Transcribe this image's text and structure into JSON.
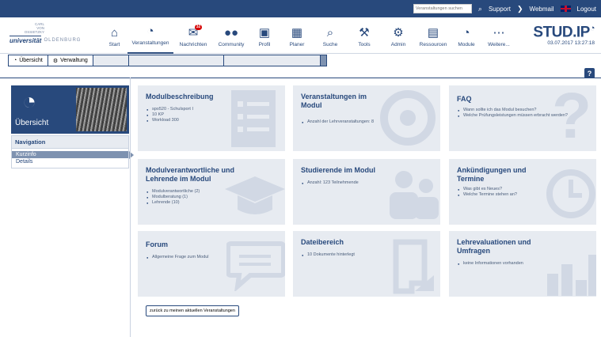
{
  "topbar": {
    "search_placeholder": "Veranstaltungen suchen",
    "support": "Support",
    "webmail": "Webmail",
    "logout": "Logout"
  },
  "logo": {
    "top_line1": "CARL",
    "top_line2": "VON",
    "top_line3": "OSSIETZKY",
    "universitaet": "universität",
    "oldenburg": "OLDENBURG"
  },
  "nav": [
    {
      "label": "Start",
      "icon": "home-icon",
      "glyph": "⌂"
    },
    {
      "label": "Veranstaltungen",
      "icon": "seminar-icon",
      "glyph": "◔"
    },
    {
      "label": "Nachrichten",
      "icon": "mail-icon",
      "glyph": "✉",
      "badge": "32"
    },
    {
      "label": "Community",
      "icon": "community-icon",
      "glyph": "👥"
    },
    {
      "label": "Profil",
      "icon": "profile-icon",
      "glyph": "▣"
    },
    {
      "label": "Planer",
      "icon": "calendar-icon",
      "glyph": "▦"
    },
    {
      "label": "Suche",
      "icon": "search-icon",
      "glyph": "⌕"
    },
    {
      "label": "Tools",
      "icon": "tools-icon",
      "glyph": "🔧"
    },
    {
      "label": "Admin",
      "icon": "admin-icon",
      "glyph": "⚙"
    },
    {
      "label": "Ressourcen",
      "icon": "resources-icon",
      "glyph": "▤"
    },
    {
      "label": "Module",
      "icon": "module-icon",
      "glyph": "◔"
    },
    {
      "label": "Weitere...",
      "icon": "more-icon",
      "glyph": "⋯"
    }
  ],
  "brand": {
    "name": "STUD.IP",
    "datetime": "03.07.2017 13:27:18"
  },
  "tabs": [
    {
      "label": "Übersicht",
      "icon": "seminar-icon"
    },
    {
      "label": "Verwaltung",
      "icon": "admin-icon"
    }
  ],
  "sidebar": {
    "image_label": "Übersicht",
    "nav_title": "Navigation",
    "items": [
      "Kurzinfo",
      "Details"
    ]
  },
  "tiles": [
    {
      "title": "Modulbeschreibung",
      "items": [
        "spo520 - Schulsport I",
        "10 KP",
        "Workload 300"
      ],
      "bg_icon": "list-icon"
    },
    {
      "title": "Veranstaltungen im Modul",
      "items": [
        "Anzahl der Lehrveranstaltungen: 8"
      ],
      "bg_icon": "seminar-icon"
    },
    {
      "title": "FAQ",
      "items": [
        "Wann sollte ich das Modul besuchen?",
        "Welche Prüfungsleistungen müssen erbracht werden?"
      ],
      "bg_icon": "question-icon"
    },
    {
      "title": "Modulverantwortliche und Lehrende im Modul",
      "items": [
        "Modulverantwortliche (2)",
        "Modulberatung (1)",
        "Lehrende (10)"
      ],
      "bg_icon": "graduation-cap-icon"
    },
    {
      "title": "Studierende im Modul",
      "items": [
        "Anzahl: 123 Teilnehmende"
      ],
      "bg_icon": "community-icon"
    },
    {
      "title": "Ankündigungen und Termine",
      "items": [
        "Was gibt es Neues?",
        "Welche Termine stehen an?"
      ],
      "bg_icon": "clock-icon"
    },
    {
      "title": "Forum",
      "items": [
        "Allgemeine Frage zum Modul"
      ],
      "bg_icon": "forum-icon"
    },
    {
      "title": "Dateibereich",
      "items": [
        "10 Dokumente hinterlegt"
      ],
      "bg_icon": "file-icon"
    },
    {
      "title": "Lehrevaluationen und Umfragen",
      "items": [
        "keine Informationen vorhanden"
      ],
      "bg_icon": "bar-chart-icon"
    }
  ],
  "back_button": "zurück zu meinen aktuellen Veranstaltungen"
}
